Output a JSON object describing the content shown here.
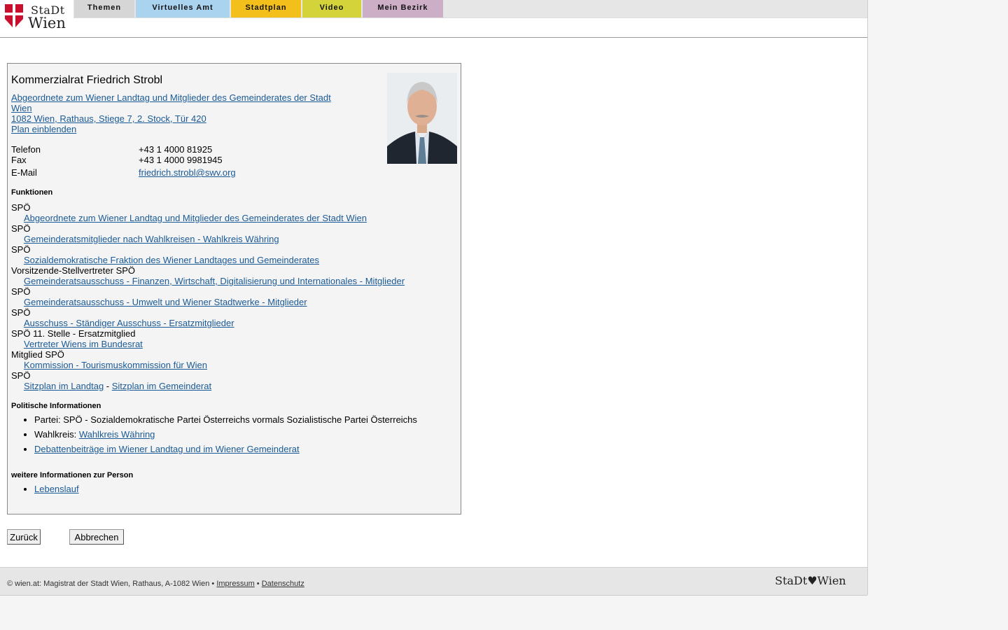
{
  "header": {
    "logo_line1": "StaDt",
    "logo_line2": "Wien",
    "tabs": [
      {
        "label": "Themen",
        "color": "#d6d6d6"
      },
      {
        "label": "Virtuelles Amt",
        "color": "#a9d3ef"
      },
      {
        "label": "Stadtplan",
        "color": "#f3c01b"
      },
      {
        "label": "Video",
        "color": "#d4d43a"
      },
      {
        "label": "Mein Bezirk",
        "color": "#cdaec7"
      }
    ]
  },
  "person": {
    "name": "Kommerzialrat Friedrich Strobl",
    "role_link": "Abgeordnete zum Wiener Landtag und Mitglieder des Gemeinderates der Stadt Wien",
    "address_link": "1082 Wien, Rathaus, Stiege 7, 2. Stock, Tür 420",
    "map_link": "Plan einblenden",
    "contact": {
      "phone_label": "Telefon",
      "phone": "+43 1 4000 81925",
      "fax_label": "Fax",
      "fax": "+43 1 4000 9981945",
      "email_label": "E-Mail",
      "email": "friedrich.strobl@swv.org"
    }
  },
  "functions": {
    "heading": "Funktionen",
    "items": [
      {
        "role": "SPÖ",
        "org": "Abgeordnete zum Wiener Landtag und Mitglieder des Gemeinderates der Stadt Wien"
      },
      {
        "role": "SPÖ",
        "org": "Gemeinderatsmitglieder nach Wahlkreisen - Wahlkreis Währing"
      },
      {
        "role": "SPÖ",
        "org": "Sozialdemokratische Fraktion des Wiener Landtages und Gemeinderates"
      },
      {
        "role": "Vorsitzende-Stellvertreter SPÖ",
        "org": "Gemeinderatsausschuss - Finanzen, Wirtschaft, Digitalisierung und Internationales - Mitglieder"
      },
      {
        "role": "SPÖ",
        "org": "Gemeinderatsausschuss - Umwelt und Wiener Stadtwerke - Mitglieder"
      },
      {
        "role": "SPÖ",
        "org": "Ausschuss - Ständiger Ausschuss - Ersatzmitglieder"
      },
      {
        "role": "SPÖ 11. Stelle - Ersatzmitglied",
        "org": "Vertreter Wiens im Bundesrat"
      },
      {
        "role": "Mitglied SPÖ",
        "org": "Kommission - Tourismuskommission für Wien"
      }
    ],
    "last_role": "SPÖ",
    "seat_landtag": "Sitzplan im Landtag",
    "seat_separator": " - ",
    "seat_gemeinderat": "Sitzplan im Gemeinderat"
  },
  "political": {
    "heading": "Politische Informationen",
    "party_label": "Partei: ",
    "party": "SPÖ - Sozialdemokratische Partei Österreichs vormals Sozialistische Partei Österreichs",
    "district_label": "Wahlkreis: ",
    "district": "Wahlkreis Währing",
    "debates": "Debattenbeiträge im Wiener Landtag und im Wiener Gemeinderat"
  },
  "more": {
    "heading": "weitere Informationen zur Person",
    "cv": "Lebenslauf"
  },
  "buttons": {
    "back": "Zurück",
    "cancel": "Abbrechen"
  },
  "footer": {
    "copyright": "© wien.at: Magistrat der Stadt Wien, Rathaus, A-1082 Wien • ",
    "impressum": "Impressum",
    "bullet": " • ",
    "privacy": "Datenschutz",
    "logo": "StaDt♥Wien"
  },
  "colors": {
    "link": "#1a5a96",
    "brand_red": "#c8102e"
  }
}
